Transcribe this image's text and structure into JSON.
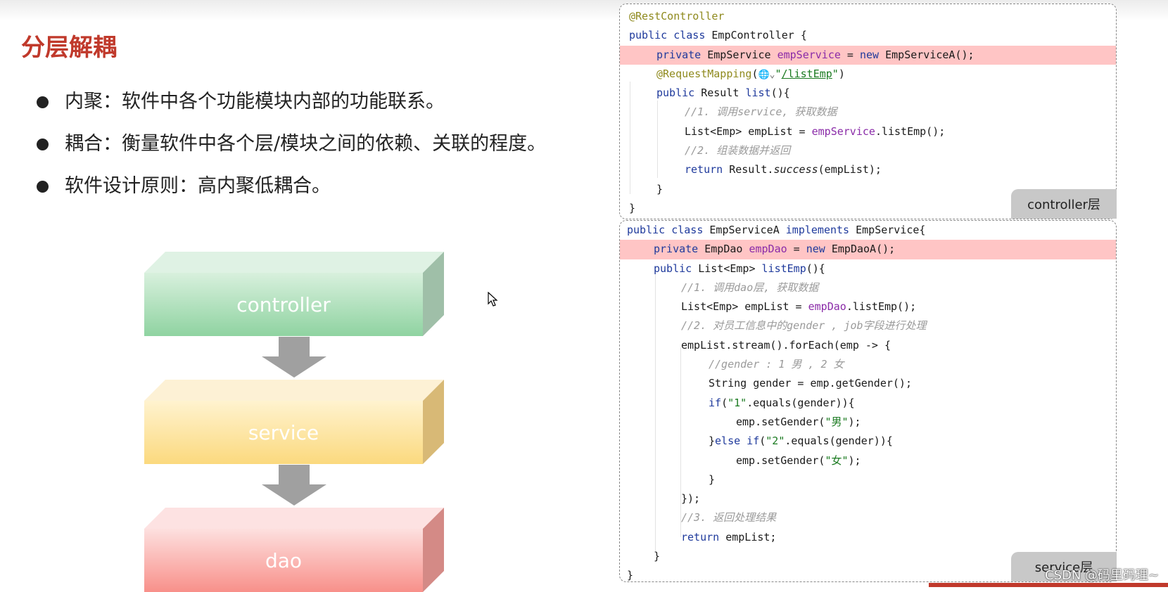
{
  "slide": {
    "title": "分层解耦",
    "bullets": [
      "内聚：软件中各个功能模块内部的功能联系。",
      "耦合：衡量软件中各个层/模块之间的依赖、关联的程度。",
      "软件设计原则：高内聚低耦合。"
    ]
  },
  "diagram": {
    "layers": [
      "controller",
      "service",
      "dao"
    ],
    "colors": {
      "controller": "#8fd3a1",
      "service": "#fbd97e",
      "dao": "#f8908a",
      "arrow": "#a0a0a0"
    }
  },
  "controller_panel": {
    "tab_label": "controller层",
    "lines": {
      "l1": "@RestController",
      "l2_kw": "public class",
      "l2_rest": " EmpController {",
      "l3_kw": "private",
      "l3_type": " EmpService ",
      "l3_field": "empService",
      "l3_eq": " = ",
      "l3_new": "new",
      "l3_rest": " EmpServiceA();",
      "l4_an": "@RequestMapping",
      "l4_open": "(",
      "l4_globe": "🌐⌄",
      "l4_q1": "\"",
      "l4_link": "/listEmp",
      "l4_q2": "\"",
      "l4_close": ")",
      "l5_kw": "public",
      "l5_rest": " Result ",
      "l5_fn": "list",
      "l5_end": "(){",
      "l6": "//1. 调用service, 获取数据",
      "l7_a": "List<Emp> empList = ",
      "l7_f": "empService",
      "l7_b": ".listEmp();",
      "l8": "//2. 组装数据并返回",
      "l9_kw": "return",
      "l9_a": " Result.",
      "l9_it": "success",
      "l9_b": "(empList);",
      "l10": "}",
      "l11": "}"
    }
  },
  "service_panel": {
    "tab_label": "service层",
    "lines": {
      "s1_kw": "public class",
      "s1_a": " EmpServiceA ",
      "s1_kw2": "implements",
      "s1_b": " EmpService{",
      "s2_kw": "private",
      "s2_a": " EmpDao ",
      "s2_f": "empDao",
      "s2_eq": " = ",
      "s2_new": "new",
      "s2_b": " EmpDaoA();",
      "s3_kw": "public",
      "s3_a": " List<Emp> ",
      "s3_fn": "listEmp",
      "s3_b": "(){",
      "s4": "//1. 调用dao层, 获取数据",
      "s5_a": "List<Emp> empList = ",
      "s5_f": "empDao",
      "s5_b": ".listEmp();",
      "s6": "//2. 对员工信息中的gender , job字段进行处理",
      "s7": "empList.stream().forEach(emp -> {",
      "s8": "//gender : 1 男 , 2 女",
      "s9": "String gender = emp.getGender();",
      "s10_kw": "if",
      "s10_a": "(",
      "s10_s": "\"1\"",
      "s10_b": ".equals(gender)){",
      "s11_a": "emp.setGender(",
      "s11_s": "\"男\"",
      "s11_b": ");",
      "s12_a": "}",
      "s12_kw": "else if",
      "s12_b": "(",
      "s12_s": "\"2\"",
      "s12_c": ".equals(gender)){",
      "s13_a": "emp.setGender(",
      "s13_s": "\"女\"",
      "s13_b": ");",
      "s14": "}",
      "s15": "});",
      "s16": "//3. 返回处理结果",
      "s17_kw": "return",
      "s17_a": " empList;",
      "s18": "}",
      "s19": "}"
    }
  },
  "watermark": "CSDN @码里码理~"
}
